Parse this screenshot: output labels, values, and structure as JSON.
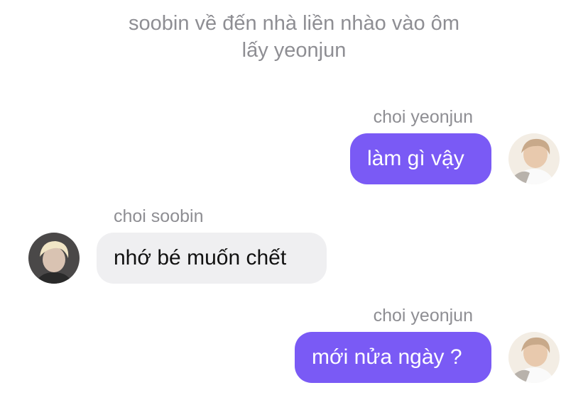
{
  "narration": {
    "line1": "soobin về đến nhà liền nhào vào ôm",
    "line2": "lấy yeonjun"
  },
  "messages": [
    {
      "sender": "choi yeonjun",
      "text": "làm gì vậy",
      "direction": "outgoing"
    },
    {
      "sender": "choi soobin",
      "text": "nhớ bé muốn chết",
      "direction": "incoming"
    },
    {
      "sender": "choi yeonjun",
      "text": "mới nửa ngày ?",
      "direction": "outgoing"
    }
  ],
  "colors": {
    "outgoing_bubble": "#7a5af5",
    "incoming_bubble": "#efeff1",
    "meta_text": "#8e8e93"
  },
  "icons": {
    "avatar_yeonjun": "avatar-yeonjun-photo",
    "avatar_soobin": "avatar-soobin-photo"
  }
}
